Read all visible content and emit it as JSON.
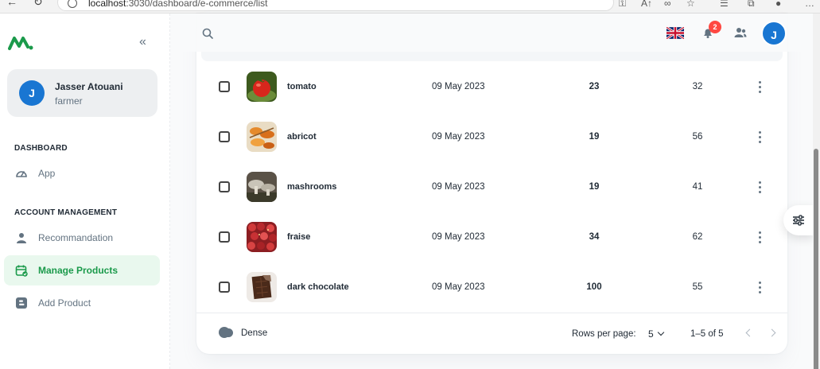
{
  "browser": {
    "url_host": "localhost",
    "url_rest": ":3030/dashboard/e-commerce/list"
  },
  "sidebar": {
    "user": {
      "initial": "J",
      "name": "Jasser Atouani",
      "role": "farmer"
    },
    "sections": [
      {
        "title": "DASHBOARD",
        "items": [
          {
            "label": "App",
            "icon": "speedometer-icon"
          }
        ]
      },
      {
        "title": "ACCOUNT MANAGEMENT",
        "items": [
          {
            "label": "Recommandation",
            "icon": "user-icon"
          },
          {
            "label": "Manage Products",
            "icon": "calendar-check-icon",
            "active": true
          },
          {
            "label": "Add Product",
            "icon": "blogger-icon"
          }
        ]
      }
    ]
  },
  "header": {
    "notifications_count": "2",
    "avatar_initial": "J"
  },
  "products": [
    {
      "name": "tomato",
      "date": "09 May 2023",
      "quantity": "23",
      "price": "32",
      "image": "tomato"
    },
    {
      "name": "abricot",
      "date": "09 May 2023",
      "quantity": "19",
      "price": "56",
      "image": "abricot"
    },
    {
      "name": "mashrooms",
      "date": "09 May 2023",
      "quantity": "19",
      "price": "41",
      "image": "mushrooms"
    },
    {
      "name": "fraise",
      "date": "09 May 2023",
      "quantity": "34",
      "price": "62",
      "image": "strawberries"
    },
    {
      "name": "dark chocolate",
      "date": "09 May 2023",
      "quantity": "100",
      "price": "55",
      "image": "chocolate"
    }
  ],
  "footer": {
    "dense_label": "Dense",
    "rows_per_page_label": "Rows per page:",
    "rows_per_page_value": "5",
    "range": "1–5 of 5"
  },
  "colors": {
    "primary": "#1976d2",
    "accent_green": "#1b9a4b",
    "badge_red": "#ff4842"
  }
}
